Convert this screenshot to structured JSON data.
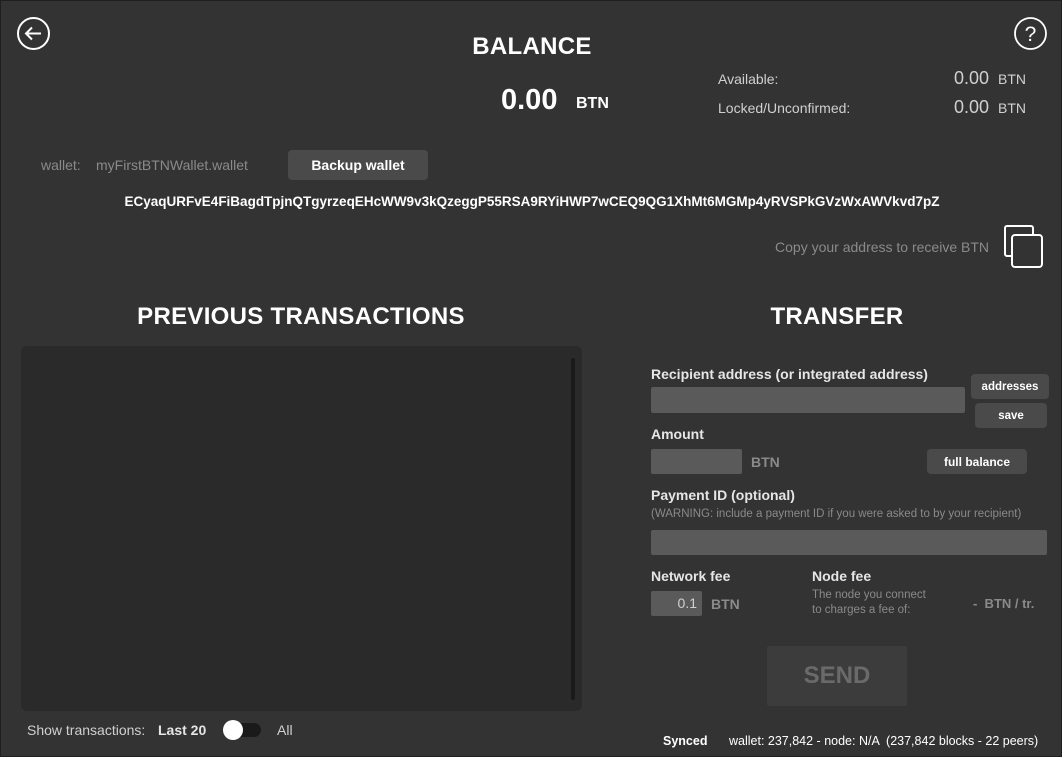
{
  "balance": {
    "title": "BALANCE",
    "amount": "0.00",
    "unit": "BTN",
    "available_label": "Available:",
    "available_value": "0.00",
    "available_unit": "BTN",
    "locked_label": "Locked/Unconfirmed:",
    "locked_value": "0.00",
    "locked_unit": "BTN"
  },
  "wallet": {
    "label": "wallet:",
    "name": "myFirstBTNWallet.wallet",
    "backup_button": "Backup wallet",
    "address": "ECyaqURFvE4FiBagdTpjnQTgyrzeqEHcWW9v3kQzeggP55RSA9RYiHWP7wCEQ9QG1XhMt6MGMp4yRVSPkGVzWxAWVkvd7pZ",
    "copy_hint": "Copy your address to receive BTN"
  },
  "transactions": {
    "title": "PREVIOUS TRANSACTIONS",
    "show_label": "Show transactions:",
    "option_last": "Last 20",
    "option_all": "All"
  },
  "transfer": {
    "title": "TRANSFER",
    "recipient_label": "Recipient address (or integrated address)",
    "addresses_button": "addresses",
    "save_button": "save",
    "amount_label": "Amount",
    "amount_unit": "BTN",
    "full_balance_button": "full balance",
    "payment_id_label": "Payment ID (optional)",
    "payment_id_warning": "(WARNING: include a payment ID if you were asked to by your recipient)",
    "network_fee_label": "Network fee",
    "network_fee_value": "0.1",
    "network_fee_unit": "BTN",
    "node_fee_label": "Node fee",
    "node_fee_desc_1": "The node you connect",
    "node_fee_desc_2": "to charges a fee of:",
    "node_fee_value": "-  BTN / tr.",
    "send_button": "SEND"
  },
  "status": {
    "synced": "Synced",
    "details": "wallet: 237,842 - node: N/A  (237,842 blocks - 22 peers)"
  },
  "icons": {
    "back": "arrow-left-circle-icon",
    "help": "question-circle-icon",
    "copy": "copy-icon"
  }
}
